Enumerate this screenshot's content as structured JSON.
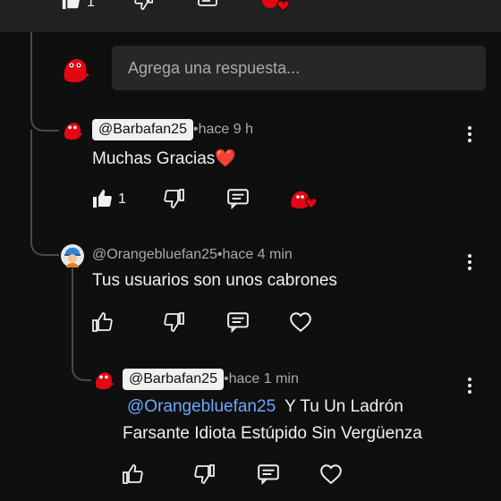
{
  "reply_placeholder": "Agrega una respuesta...",
  "top_actions": {
    "like_count": "1"
  },
  "comments": [
    {
      "handle": "@Barbafan25",
      "separator": " • ",
      "time": "hace 9 h",
      "text": "Muchas Gracias",
      "emoji": "❤️",
      "like_count": "1"
    },
    {
      "handle": "@Orangebluefan25",
      "separator": " • ",
      "time": "hace 4 min",
      "text": "Tus usuarios son unos cabrones"
    },
    {
      "handle": "@Barbafan25",
      "separator": " • ",
      "time": "hace 1 min",
      "mention": "@Orangebluefan25",
      "text_line1": " Y Tu Un Ladrón",
      "text_line2": "Farsante Idiota Estúpido Sin Vergüenza"
    }
  ],
  "icons": {
    "like": "thumb-up-icon",
    "dislike": "thumb-down-icon",
    "reply": "comment-icon",
    "heart": "heart-icon",
    "creator_heart": "creator-heart-icon",
    "more": "more-vert-icon"
  },
  "colors": {
    "background": "#0f0f0f",
    "top_bar": "#212121",
    "reply_box": "#272727",
    "mention": "#6aa8ff",
    "heart_red": "#e30613"
  }
}
